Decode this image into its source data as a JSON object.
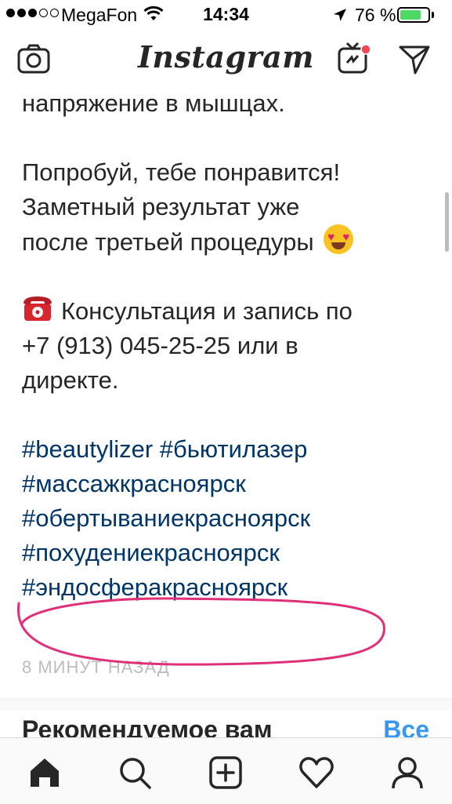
{
  "status_bar": {
    "carrier": "MegaFon",
    "time": "14:34",
    "battery_percent": "76 %",
    "battery_level": 0.76,
    "signal_bars_filled": 3,
    "signal_bars_total": 5
  },
  "header": {
    "logo": "Instagram",
    "icons": [
      "camera-icon",
      "igtv-icon",
      "direct-message-icon"
    ]
  },
  "post": {
    "caption_lines": [
      "напряжение в мышцах.",
      "",
      "Попробуй, тебе понравится!",
      "Заметный результат уже",
      "после третьей процедуры",
      "",
      "Консультация и запись по",
      "+7 (913) 045-25-25 или в",
      "директе."
    ],
    "hashtags": [
      "#beautylizer #бьютилазер",
      "#массажкрасноярск",
      "#обертываниекрасноярск",
      "#похудениекрасноярск",
      "#эндосферакрасноярск"
    ],
    "time_ago": "8 МИНУТ НАЗАД",
    "emoji": "smiling-face-with-heart-eyes",
    "phone_emoji": "telephone"
  },
  "recommended": {
    "title": "Рекомендуемое вам",
    "see_all": "Все"
  },
  "tab_bar": {
    "items": [
      "home-icon",
      "search-icon",
      "new-post-icon",
      "activity-heart-icon",
      "profile-icon"
    ]
  },
  "colors": {
    "hashtag": "#003569",
    "link_blue": "#3897f0",
    "highlight_pink": "#e0307a",
    "battery_green": "#4cd964",
    "notification_red": "#ed4956"
  }
}
